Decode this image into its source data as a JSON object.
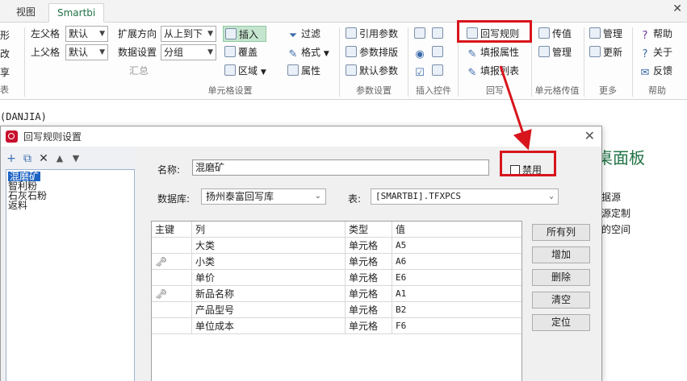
{
  "tabs": [
    {
      "label": "视图"
    },
    {
      "label": "Smartbi"
    }
  ],
  "ribbon": {
    "partial_left": [
      "形",
      "改",
      "享",
      "表"
    ],
    "left_parent_label": "左父格",
    "left_parent_value": "默认",
    "top_parent_label": "上父格",
    "top_parent_value": "默认",
    "expand_dir_label": "扩展方向",
    "expand_dir_value": "从上到下",
    "data_setting_label": "数据设置",
    "data_setting_value": "分组",
    "summary_label": "汇总",
    "insert_label": "插入",
    "cover_label": "覆盖",
    "area_label": "区域",
    "filter_label": "过滤",
    "format_label": "格式",
    "property_label": "属性",
    "cell_settings_group": "单元格设置",
    "ref_param_label": "引用参数",
    "param_layout_label": "参数排版",
    "default_param_label": "默认参数",
    "param_settings_group": "参数设置",
    "insert_control_group": "插入控件",
    "writeback_rule_label": "回写规则",
    "fill_property_label": "填报属性",
    "fill_list_label": "填报列表",
    "writeback_group": "回写",
    "pass_value_label": "传值",
    "manage2_label": "管理",
    "cell_pass_group": "单元格传值",
    "manage_label": "管理",
    "update_label": "更新",
    "more_group": "更多",
    "help_label": "帮助",
    "about_label": "关于",
    "feedback_label": "反馈",
    "help_group": "帮助"
  },
  "formula_text": "(DANJIA)",
  "background": {
    "panel_title": "桌面板",
    "lines": [
      "据源",
      "源定制",
      "的空间"
    ]
  },
  "dialog": {
    "title": "回写规则设置",
    "list_items": [
      "混磨矿",
      "智利粉",
      "石灰石粉",
      "返料"
    ],
    "name_label": "名称:",
    "name_value": "混磨矿",
    "disable_label": "禁用",
    "db_label": "数据库:",
    "db_value": "扬州泰富回写库",
    "table_label": "表:",
    "table_value": "[SMARTBI].TFXPCS",
    "grid": {
      "headers": [
        "主键",
        "列",
        "类型",
        "值"
      ],
      "rows": [
        {
          "key": false,
          "column": "大类",
          "type": "单元格",
          "value": "A5"
        },
        {
          "key": true,
          "column": "小类",
          "type": "单元格",
          "value": "A6"
        },
        {
          "key": false,
          "column": "单价",
          "type": "单元格",
          "value": "E6"
        },
        {
          "key": true,
          "column": "新品名称",
          "type": "单元格",
          "value": "A1"
        },
        {
          "key": false,
          "column": "产品型号",
          "type": "单元格",
          "value": "B2"
        },
        {
          "key": false,
          "column": "单位成本",
          "type": "单元格",
          "value": "F6"
        }
      ]
    },
    "buttons": {
      "all_columns": "所有列",
      "add": "增加",
      "delete": "删除",
      "clear": "清空",
      "locate": "定位"
    }
  },
  "colors": {
    "accent_green": "#217346",
    "highlight_red": "#d8141c",
    "selection_blue": "#1d63c4"
  }
}
